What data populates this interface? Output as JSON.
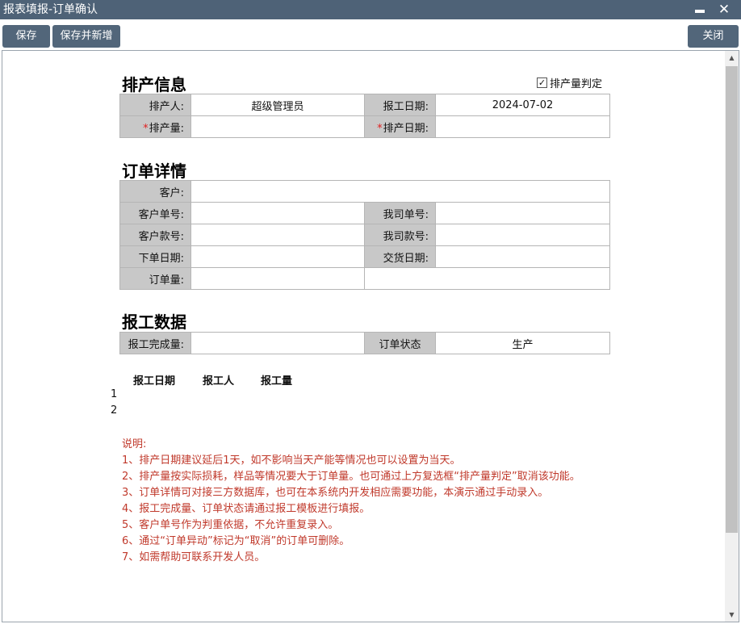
{
  "window": {
    "title": "报表填报-订单确认"
  },
  "toolbar": {
    "save_label": "保存",
    "save_new_label": "保存并新增",
    "close_label": "关闭"
  },
  "schedule": {
    "title": "排产信息",
    "checkbox_label": "排产量判定",
    "checkbox_checked": true,
    "scheduler_label": "排产人:",
    "scheduler_value": "超级管理员",
    "report_date_label": "报工日期:",
    "report_date_value": "2024-07-02",
    "qty_label": "排产量:",
    "qty_value": "",
    "date_label": "排产日期:",
    "date_value": ""
  },
  "order": {
    "title": "订单详情",
    "customer_label": "客户:",
    "customer_value": "",
    "customer_no_label": "客户单号:",
    "our_no_label": "我司单号:",
    "customer_style_label": "客户款号:",
    "our_style_label": "我司款号:",
    "order_date_label": "下单日期:",
    "delivery_date_label": "交货日期:",
    "order_qty_label": "订单量:"
  },
  "report": {
    "title": "报工数据",
    "done_qty_label": "报工完成量:",
    "done_qty_value": "",
    "status_label": "订单状态",
    "status_value": "生产",
    "columns": [
      "报工日期",
      "报工人",
      "报工量"
    ],
    "rows": [
      "1",
      "2"
    ]
  },
  "notes": {
    "header": "说明:",
    "items": [
      "1、排产日期建议延后1天，如不影响当天产能等情况也可以设置为当天。",
      "2、排产量按实际损耗，样品等情况要大于订单量。也可通过上方复选框“排产量判定”取消该功能。",
      "3、订单详情可对接三方数据库，也可在本系统内开发相应需要功能，本演示通过手动录入。",
      "4、报工完成量、订单状态请通过报工模板进行填报。",
      "5、客户单号作为判重依据，不允许重复录入。",
      "6、通过“订单异动”标记为“取消”的订单可删除。",
      "7、如需帮助可联系开发人员。"
    ]
  }
}
